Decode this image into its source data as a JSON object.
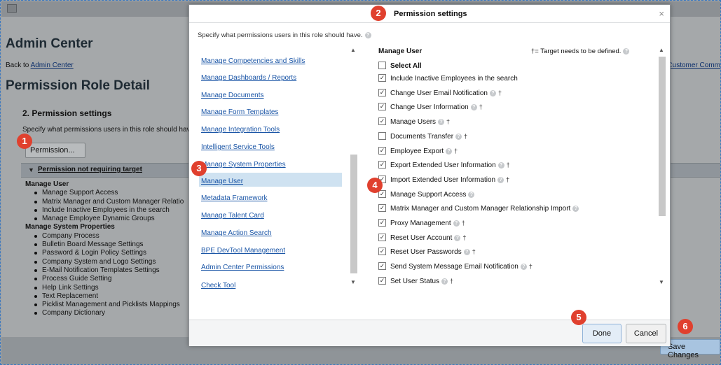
{
  "background": {
    "page_title": "Admin Center",
    "back_prefix": "Back to ",
    "back_link": "Admin Center",
    "customer_link": "Customer Comm",
    "section_title": "Permission Role Detail",
    "step_title": "2. Permission settings",
    "step_desc": "Specify what permissions users in this role should hav",
    "permission_button": "Permission...",
    "collapsed_section": "Permission not requiring target",
    "groups": [
      {
        "label": "Manage User",
        "items": [
          "Manage Support Access",
          "Matrix Manager and Custom Manager Relatio",
          "Include Inactive Employees in the search",
          "Manage Employee Dynamic Groups"
        ]
      },
      {
        "label": "Manage System Properties",
        "items": [
          "Company Process",
          "Bulletin Board Message Settings",
          "Password & Login Policy Settings",
          "Company System and Logo Settings",
          "E-Mail Notification Templates Settings",
          "Process Guide Setting",
          "Help Link Settings",
          "Text Replacement",
          "Picklist Management and Picklists Mappings",
          "Company Dictionary"
        ]
      }
    ],
    "save_button": "Save Changes"
  },
  "modal": {
    "title": "Permission settings",
    "close_glyph": "×",
    "intro": "Specify what permissions users in this role should have.",
    "left_links": [
      "Manage Competencies and Skills",
      "Manage Dashboards / Reports",
      "Manage Documents",
      "Manage Form Templates",
      "Manage Integration Tools",
      "Intelligent Service Tools",
      "Manage System Properties",
      "Manage User",
      "Metadata Framework",
      "Manage Talent Card",
      "Manage Action Search",
      "BPE DevTool Management",
      "Admin Center Permissions",
      "Check Tool"
    ],
    "left_selected": "Manage User",
    "right_header": "Manage User",
    "target_note": "†= Target needs to be defined.",
    "select_all": "Select All",
    "permissions": [
      {
        "label": "Include Inactive Employees in the search",
        "checked": true,
        "help": false,
        "dagger": false
      },
      {
        "label": "Change User Email Notification",
        "checked": true,
        "help": true,
        "dagger": true
      },
      {
        "label": "Change User Information",
        "checked": true,
        "help": true,
        "dagger": true
      },
      {
        "label": "Manage Users",
        "checked": true,
        "help": true,
        "dagger": true
      },
      {
        "label": "Documents Transfer",
        "checked": false,
        "help": true,
        "dagger": true
      },
      {
        "label": "Employee Export",
        "checked": true,
        "help": true,
        "dagger": true
      },
      {
        "label": "Export Extended User Information",
        "checked": true,
        "help": true,
        "dagger": true
      },
      {
        "label": "Import Extended User Information",
        "checked": true,
        "help": true,
        "dagger": true
      },
      {
        "label": "Manage Support Access",
        "checked": true,
        "help": true,
        "dagger": false
      },
      {
        "label": "Matrix Manager and Custom Manager Relationship Import",
        "checked": true,
        "help": true,
        "dagger": false
      },
      {
        "label": "Proxy Management",
        "checked": true,
        "help": true,
        "dagger": true
      },
      {
        "label": "Reset User Account",
        "checked": true,
        "help": true,
        "dagger": true
      },
      {
        "label": "Reset User Passwords",
        "checked": true,
        "help": true,
        "dagger": true
      },
      {
        "label": "Send System Message Email Notification",
        "checked": true,
        "help": true,
        "dagger": true
      },
      {
        "label": "Set User Status",
        "checked": true,
        "help": true,
        "dagger": true
      }
    ],
    "dagger_glyph": "†",
    "help_glyph": "?",
    "check_glyph": "✓",
    "done_button": "Done",
    "cancel_button": "Cancel"
  },
  "callouts": [
    "1",
    "2",
    "3",
    "4",
    "5",
    "6"
  ],
  "colors": {
    "callout": "#e0402e",
    "link": "#1a55a6",
    "selected_row": "#cfe2f1"
  }
}
